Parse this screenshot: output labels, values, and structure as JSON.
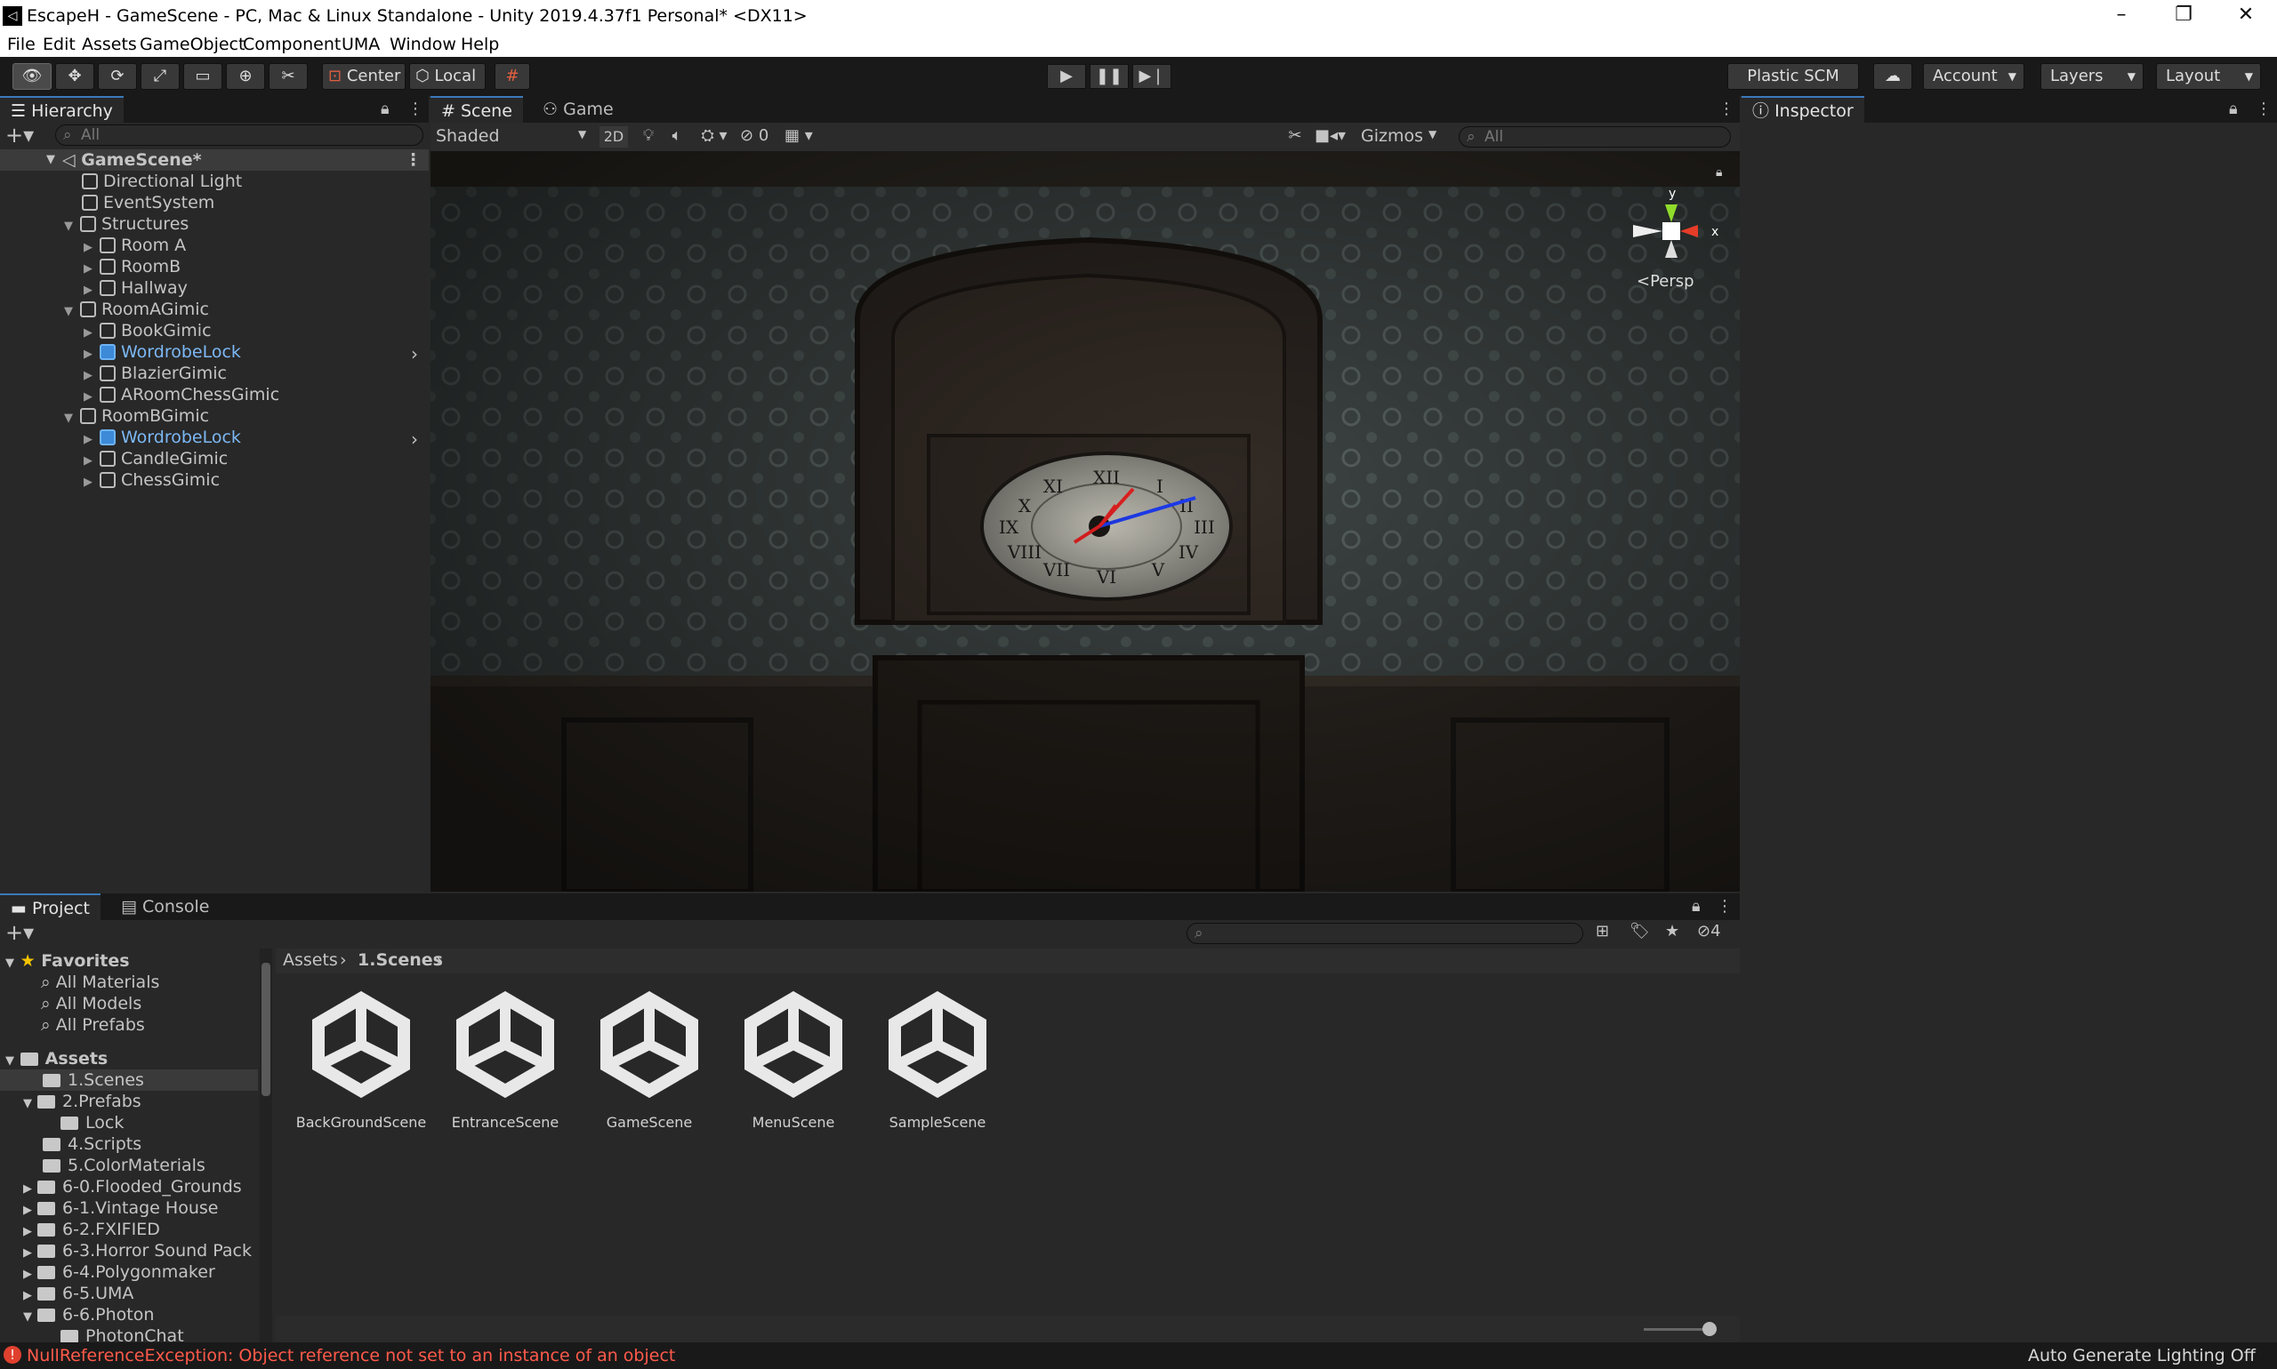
{
  "window": {
    "title": "EscapeH - GameScene - PC, Mac & Linux Standalone - Unity 2019.4.37f1 Personal* <DX11>",
    "logo": "unity-logo"
  },
  "menu": [
    "File",
    "Edit",
    "Assets",
    "GameObject",
    "Component",
    "UMA",
    "Window",
    "Help"
  ],
  "toolbar": {
    "pivot": "Center",
    "space": "Local",
    "plastic": "Plastic SCM",
    "account": "Account",
    "layers": "Layers",
    "layout": "Layout"
  },
  "hierarchy": {
    "tab": "Hierarchy",
    "search_placeholder": "All",
    "root": "GameScene*",
    "items": [
      {
        "label": "Directional Light"
      },
      {
        "label": "EventSystem"
      },
      {
        "label": "Structures"
      },
      {
        "label": "Room A"
      },
      {
        "label": "RoomB"
      },
      {
        "label": "Hallway"
      },
      {
        "label": "RoomAGimic"
      },
      {
        "label": "BookGimic"
      },
      {
        "label": "WordrobeLock"
      },
      {
        "label": "BlazierGimic"
      },
      {
        "label": "ARoomChessGimic"
      },
      {
        "label": "RoomBGimic"
      },
      {
        "label": "WordrobeLock"
      },
      {
        "label": "CandleGimic"
      },
      {
        "label": "ChessGimic"
      }
    ]
  },
  "scene": {
    "tabs": [
      "Scene",
      "Game"
    ],
    "shading": "Shaded",
    "mode2d": "2D",
    "hidden_count": "0",
    "gizmos": "Gizmos",
    "search_placeholder": "All",
    "persp": "Persp",
    "axis_y": "y",
    "axis_x": "x"
  },
  "inspector": {
    "tab": "Inspector"
  },
  "project": {
    "tabs": [
      "Project",
      "Console"
    ],
    "hidden_count": "4",
    "favorites": {
      "label": "Favorites",
      "items": [
        "All Materials",
        "All Models",
        "All Prefabs"
      ]
    },
    "assets_label": "Assets",
    "folders": [
      "1.Scenes",
      "2.Prefabs",
      "Lock",
      "4.Scripts",
      "5.ColorMaterials",
      "6-0.Flooded_Grounds",
      "6-1.Vintage House",
      "6-2.FXIFIED",
      "6-3.Horror Sound Pack",
      "6-4.Polygonmaker",
      "6-5.UMA",
      "6-6.Photon",
      "PhotonChat"
    ],
    "breadcrumb": [
      "Assets",
      "1.Scenes"
    ],
    "scenes": [
      "BackGroundScene",
      "EntranceScene",
      "GameScene",
      "MenuScene",
      "SampleScene"
    ]
  },
  "status": {
    "error": "NullReferenceException: Object reference not set to an instance of an object",
    "lighting": "Auto Generate Lighting Off"
  },
  "colors": {
    "selection": "#2c5d87",
    "prefab": "#7cb8f4",
    "error": "#ff5a4a",
    "accent_tab": "#3a79bb"
  }
}
